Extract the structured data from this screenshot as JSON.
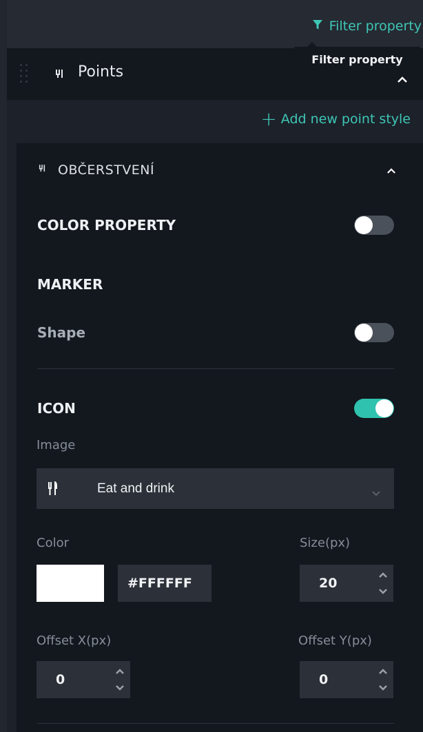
{
  "toolbar": {
    "filter_label": "Filter property",
    "tooltip": "Filter property"
  },
  "points": {
    "title": "Points",
    "icon": "fork-knife-icon",
    "add_new_label": "Add new point style"
  },
  "style": {
    "title": "OBČERSTVENÍ",
    "icon": "fork-knife-icon",
    "color_property": {
      "label": "COLOR PROPERTY",
      "enabled": false
    },
    "marker": {
      "heading": "MARKER",
      "shape_label": "Shape",
      "shape_enabled": false
    },
    "icon_section": {
      "heading": "ICON",
      "enabled": true,
      "image_label": "Image",
      "image_value": "Eat and drink",
      "image_icon": "fork-knife-icon",
      "color_label": "Color",
      "color_value": "#FFFFFF",
      "size_label": "Size(px)",
      "size_value": "20",
      "offset_x_label": "Offset X(px)",
      "offset_x_value": "0",
      "offset_y_label": "Offset Y(px)",
      "offset_y_value": "0"
    }
  },
  "colors": {
    "accent": "#3fc6b5",
    "toggle_on": "#2fc2af",
    "toggle_off": "#4b515a",
    "panel": "#13171e",
    "input": "#2c3139"
  }
}
